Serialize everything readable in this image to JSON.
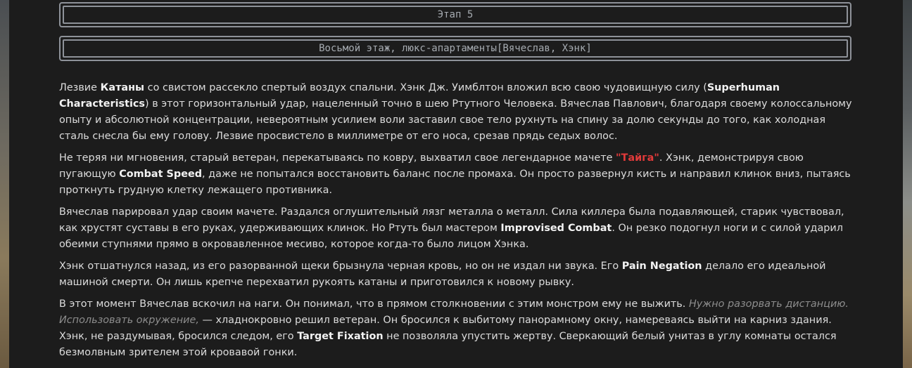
{
  "stage_title": "Этап 5",
  "location_title": "Восьмой этаж, люкс-апартаменты[Вячеслав, Хэнк]",
  "paragraphs": {
    "p1": {
      "t1": "Лезвие ",
      "b1": "Катаны",
      "t2": " со свистом рассекло спертый воздух спальни. Хэнк Дж. Уимблтон вложил всю свою чудовищную силу (",
      "b2": "Superhuman Characteristics",
      "t3": ") в этот горизонтальный удар, нацеленный точно в шею Ртутного Человека. Вячеслав Павлович, благодаря своему колоссальному опыту и абсолютной концентрации, невероятным усилием воли заставил свое тело рухнуть на спину за долю секунды до того, как холодная сталь снесла бы ему голову. Лезвие просвистело в миллиметре от его носа, срезав прядь седых волос."
    },
    "p2": {
      "t1": "Не теряя ни мгновения, старый ветеран, перекатываясь по ковру, выхватил свое легендарное мачете ",
      "r1": "\"Тайга\"",
      "t2": ". Хэнк, демонстрируя свою пугающую ",
      "b1": "Combat Speed",
      "t3": ", даже не попытался восстановить баланс после промаха. Он просто развернул кисть и направил клинок вниз, пытаясь проткнуть грудную клетку лежащего противника."
    },
    "p3": {
      "t1": "Вячеслав парировал удар своим мачете. Раздался оглушительный лязг металла о металл. Сила киллера была подавляющей, старик чувствовал, как хрустят суставы в его руках, удерживающих клинок. Но Ртуть был мастером ",
      "b1": "Improvised Combat",
      "t2": ". Он резко подогнул ноги и с силой ударил обеими ступнями прямо в окровавленное месиво, которое когда-то было лицом Хэнка."
    },
    "p4": {
      "t1": "Хэнк отшатнулся назад, из его разорванной щеки брызнула черная кровь, но он не издал ни звука. Его ",
      "b1": "Pain Negation",
      "t2": " делало его идеальной машиной смерти. Он лишь крепче перехватил рукоять катаны и приготовился к новому рывку."
    },
    "p5": {
      "t1": "В этот момент Вячеслав вскочил на наги. Он понимал, что в прямом столкновении с этим монстром ему не выжить. ",
      "i1": "Нужно разорвать дистанцию. Использовать окружение,",
      "t2": " — хладнокровно решил ветеран. Он бросился к выбитому панорамному окну, намереваясь выйти на карниз здания. Хэнк, не раздумывая, бросился следом, его ",
      "b1": "Target Fixation",
      "t3": " не позволяла упустить жертву. Сверкающий белый унитаз в углу комнаты остался безмолвным зрителем этой кровавой гонки."
    }
  }
}
